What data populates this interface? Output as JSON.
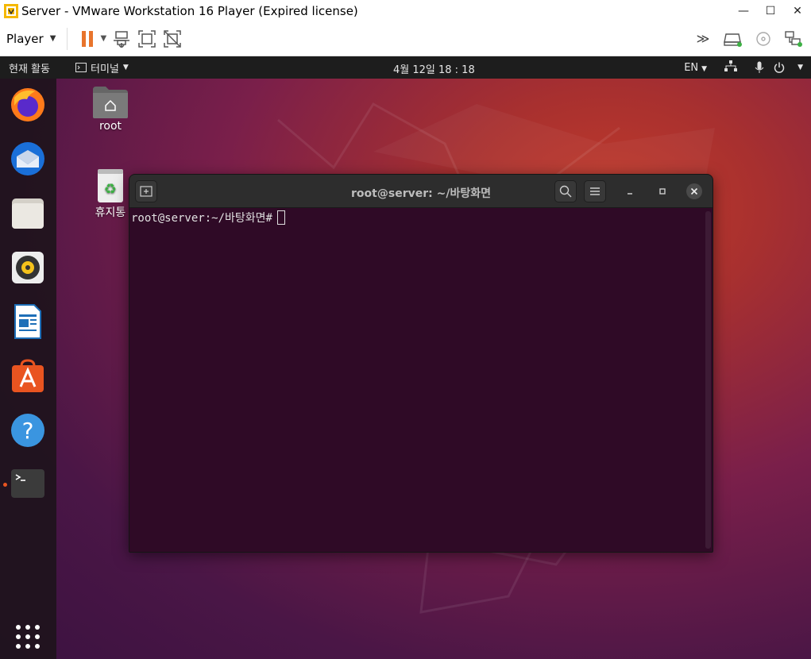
{
  "vmware": {
    "title": "Server - VMware Workstation 16 Player (Expired license)",
    "player_menu": "Player"
  },
  "colors": {
    "ubuntu_orange": "#e95420",
    "terminal_bg": "#2f0a26",
    "topbar_bg": "#1d1d1d"
  },
  "ubuntu": {
    "activities": "현재 활동",
    "app_menu": "터미널",
    "clock": "4월 12일  18 : 18",
    "language": "EN"
  },
  "dock": {
    "items": [
      {
        "name": "firefox-icon"
      },
      {
        "name": "thunderbird-icon"
      },
      {
        "name": "files-icon"
      },
      {
        "name": "rhythmbox-icon"
      },
      {
        "name": "libreoffice-writer-icon"
      },
      {
        "name": "software-icon"
      },
      {
        "name": "help-icon"
      },
      {
        "name": "terminal-icon"
      }
    ]
  },
  "desktop": {
    "home_label": "root",
    "trash_label": "휴지통"
  },
  "terminal": {
    "title": "root@server: ~/바탕화면",
    "prompt": "root@server:~/바탕화면#"
  }
}
